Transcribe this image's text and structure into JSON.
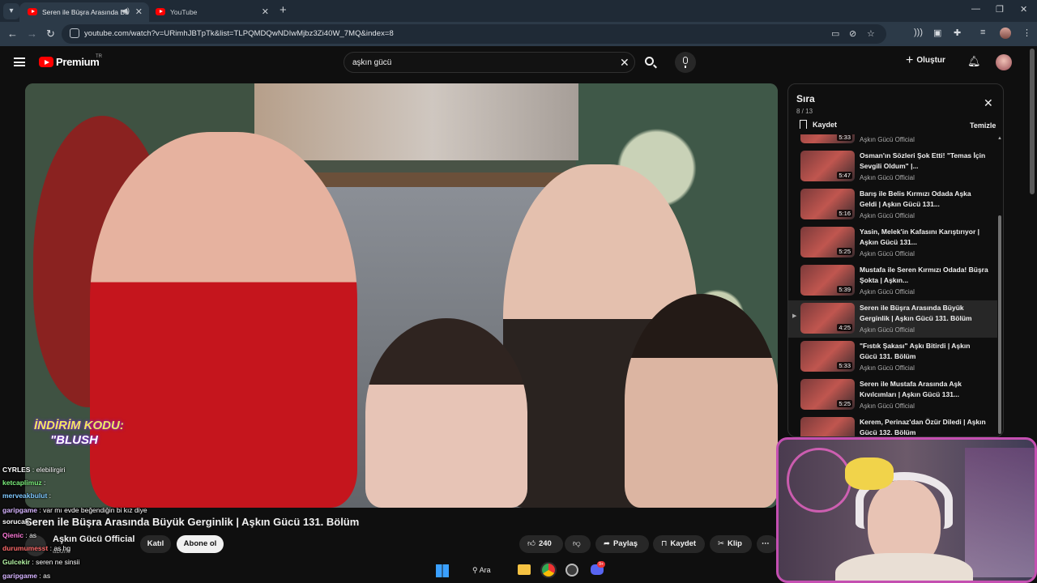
{
  "browser": {
    "tabs": [
      {
        "title": "Seren ile Büşra Arasında Bü",
        "active": true
      },
      {
        "title": "YouTube",
        "active": false
      }
    ],
    "url": "youtube.com/watch?v=URimhJBTpTk&list=TLPQMDQwNDIwMjbz3Zi40W_7MQ&index=8"
  },
  "header": {
    "brand": "Premium",
    "country": "TR",
    "search_value": "aşkın gücü",
    "create_label": "Oluştur"
  },
  "video": {
    "promo_line1": "İNDİRİM KODU:",
    "promo_line2": "\"BLUSH",
    "title": "Seren ile Büşra Arasında Büyük Gerginlik | Aşkın Gücü 131. Bölüm",
    "channel": "Aşkın Gücü Official",
    "subs": "abone",
    "join_label": "Katıl",
    "subscribe_label": "Abone ol",
    "likes": "240",
    "share_label": "Paylaş",
    "save_label": "Kaydet",
    "clip_label": "Klip"
  },
  "chat": [
    {
      "user": "CYRLES",
      "msg": ": elebilirgiri",
      "color": "#ffffff"
    },
    {
      "user": "ketcaplimuz",
      "msg": ":",
      "color": "#7cf07c"
    },
    {
      "user": "merveakbulut",
      "msg": ":",
      "color": "#7fc9ff"
    },
    {
      "user": "garipgame",
      "msg": ": var mı evde beğendiğin bi kız diye",
      "color": "#d6b4ff"
    },
    {
      "user": "sorucak",
      "msg": "",
      "color": "#ffffff"
    },
    {
      "user": "Qienic",
      "msg": ": as",
      "color": "#ff7ad9"
    },
    {
      "user": "durumumesst",
      "msg": ": as hg",
      "color": "#ff6b6b"
    },
    {
      "user": "Gulcekir",
      "msg": ": seren ne sinsii",
      "color": "#b5f5a5"
    },
    {
      "user": "garipgame",
      "msg": ": as",
      "color": "#d6b4ff"
    }
  ],
  "queue": {
    "title": "Sıra",
    "count": "8 / 13",
    "save_label": "Kaydet",
    "clear_label": "Temizle",
    "items": [
      {
        "title": "",
        "channel": "Aşkın Gücü Official",
        "duration": "5:33",
        "current": false
      },
      {
        "title": "Osman'ın Sözleri Şok Etti! \"Temas İçin Sevgili Oldum\" |...",
        "channel": "Aşkın Gücü Official",
        "duration": "5:47",
        "current": false
      },
      {
        "title": "Barış ile Belis Kırmızı Odada Aşka Geldi | Aşkın Gücü 131...",
        "channel": "Aşkın Gücü Official",
        "duration": "5:16",
        "current": false
      },
      {
        "title": "Yasin, Melek'in Kafasını Karıştırıyor | Aşkın Gücü 131...",
        "channel": "Aşkın Gücü Official",
        "duration": "5:25",
        "current": false
      },
      {
        "title": "Mustafa ile Seren Kırmızı Odada! Büşra Şokta | Aşkın...",
        "channel": "Aşkın Gücü Official",
        "duration": "5:39",
        "current": false
      },
      {
        "title": "Seren ile Büşra Arasında Büyük Gerginlik | Aşkın Gücü 131. Bölüm",
        "channel": "Aşkın Gücü Official",
        "duration": "4:25",
        "current": true
      },
      {
        "title": "\"Fıstık Şakası\" Aşkı Bitirdi | Aşkın Gücü 131. Bölüm",
        "channel": "Aşkın Gücü Official",
        "duration": "5:33",
        "current": false
      },
      {
        "title": "Seren ile Mustafa Arasında Aşk Kıvılcımları | Aşkın Gücü 131...",
        "channel": "Aşkın Gücü Official",
        "duration": "5:25",
        "current": false
      },
      {
        "title": "Kerem, Perinaz'dan Özür Diledi | Aşkın Gücü 132. Bölüm",
        "channel": "",
        "duration": "",
        "current": false
      }
    ]
  },
  "taskbar": {
    "search_label": "Ara",
    "badge": "9+"
  }
}
